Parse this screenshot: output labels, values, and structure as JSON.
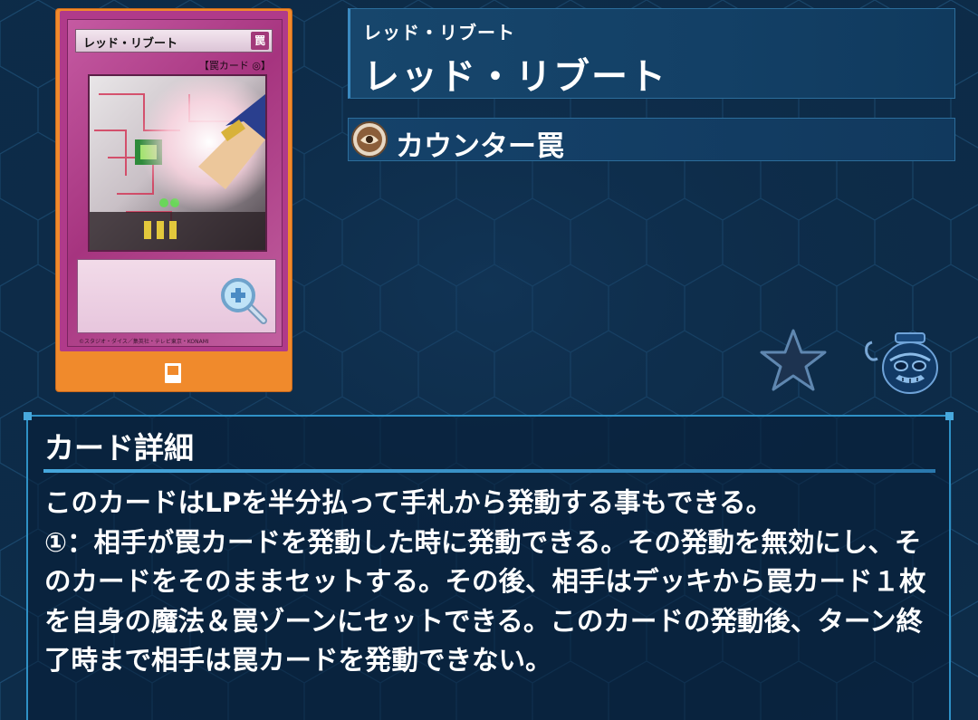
{
  "card": {
    "name": "レッド・リブート",
    "attribute_glyph": "罠",
    "type_line": "【罠カード ◎】",
    "copyright": "©スタジオ・ダイス／集英社・テレビ東京・KONAMI"
  },
  "header": {
    "name_ruby": "レッド・リブート",
    "name": "レッド・リブート"
  },
  "type": {
    "label": "カウンター罠"
  },
  "details": {
    "heading": "カード詳細",
    "text": "このカードはLPを半分払って手札から発動する事もできる。\n①：相手が罠カードを発動した時に発動できる。その発動を無効にし、そのカードをそのままセットする。その後、相手はデッキから罠カード１枚を自身の魔法＆罠ゾーンにセットできる。このカードの発動後、ターン終了時まで相手は罠カードを発動できない。"
  },
  "icons": {
    "zoom": "zoom-in-icon",
    "card_footer": "card-icon",
    "type": "counter-trap-icon",
    "favorite": "star-icon",
    "mascot": "pot-mascot-icon"
  },
  "colors": {
    "background": "#0d2c49",
    "panel_border": "#2f91c6",
    "card_frame": "#f08a2c",
    "trap_card": "#b03a8a"
  }
}
